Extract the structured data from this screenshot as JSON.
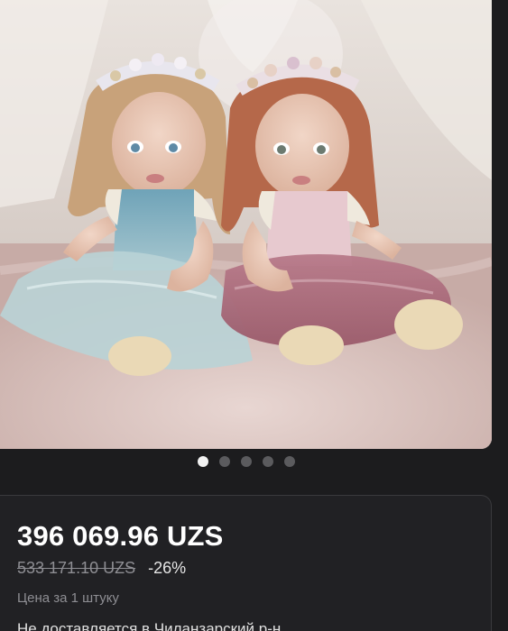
{
  "product": {
    "image_alt": "Две куклы в платьях",
    "gallery_count": 5,
    "gallery_active_index": 0,
    "price": "396 069.96 UZS",
    "old_price": "533 171.10 UZS",
    "discount": "-26%",
    "per_unit": "Цена за 1 штуку",
    "delivery": "Не доставляется в Чиланзарский р-н"
  },
  "colors": {
    "background": "#1c1c1e",
    "card": "#212124",
    "dot_active": "#f2f2f2",
    "dot_inactive": "#5b5b5e"
  }
}
